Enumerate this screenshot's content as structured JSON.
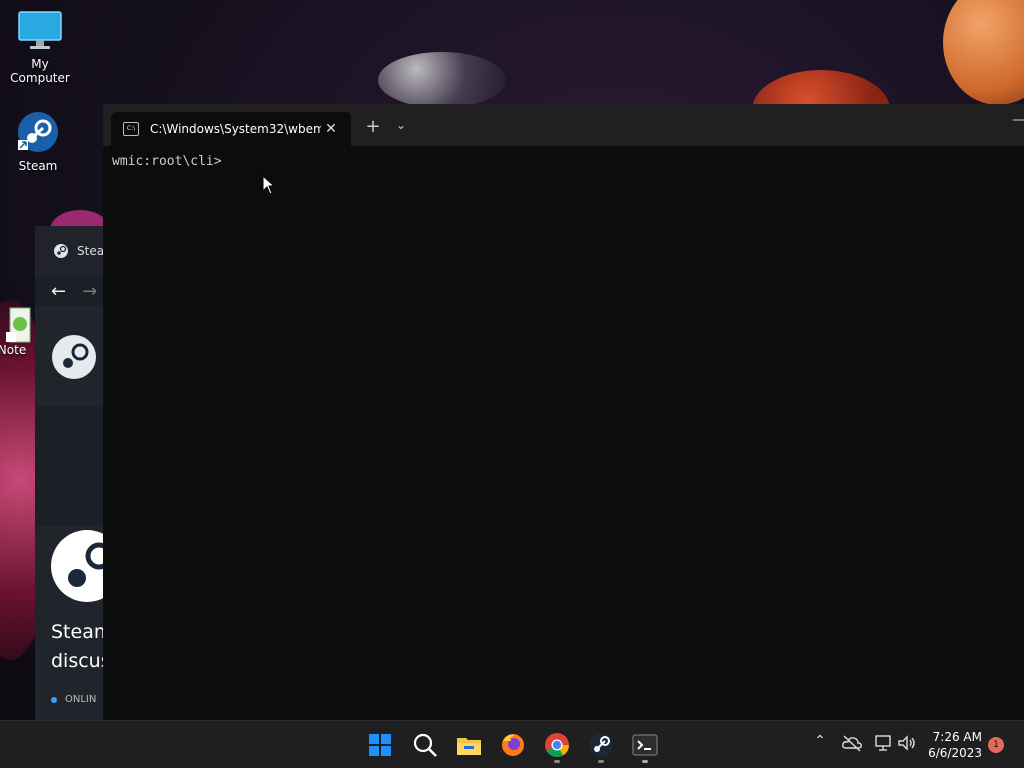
{
  "desktop": {
    "icons": [
      {
        "label": "My Computer"
      },
      {
        "label": "Steam"
      },
      {
        "label": "Note"
      }
    ]
  },
  "steam_window": {
    "tab_label": "Stea",
    "heading_partial": [
      "Steam",
      "discus"
    ],
    "online_label": "ONLIN"
  },
  "terminal": {
    "tab_title": "C:\\Windows\\System32\\wbem",
    "tab_icon": "terminal-icon",
    "prompt": "wmic:root\\cli>",
    "new_tab_label": "+",
    "dropdown_label": "⌄",
    "minimize_label": "—",
    "close_label": "✕"
  },
  "taskbar": {
    "apps": [
      "start-icon",
      "search-icon",
      "file-explorer-icon",
      "firefox-icon",
      "chrome-icon",
      "steam-icon",
      "terminal-icon"
    ],
    "tray": [
      "chevron-up-icon",
      "cloud-off-icon",
      "network-icon",
      "volume-icon"
    ],
    "time": "7:26 AM",
    "date": "6/6/2023",
    "notification_count": "1"
  },
  "colors": {
    "taskbar_bg": "#1f1f1f",
    "terminal_bg": "#0c0c0c",
    "accent_blue": "#0a84ff",
    "notification_badge": "#e06c5e"
  }
}
